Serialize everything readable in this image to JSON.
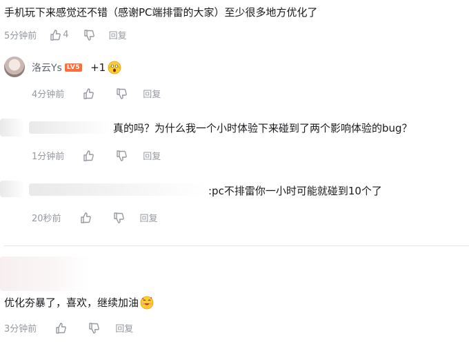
{
  "comments": [
    {
      "text": "手机玩下来感觉还不错（感谢PC端排雷的大家）至少很多地方优化了",
      "time": "5分钟前",
      "likes": "4",
      "reply_label": "回复"
    },
    {
      "username": "洛云Ys",
      "level": "LV5",
      "text": "+1",
      "time": "4分钟前",
      "reply_label": "回复"
    },
    {
      "text": "真的吗？为什么我一个小时体验下来碰到了两个影响体验的bug？",
      "time": "1分钟前",
      "reply_label": "回复"
    },
    {
      "text": ":pc不排雷你一小时可能就碰到10个了",
      "time": "20秒前",
      "reply_label": "回复"
    },
    {
      "text": "优化夯暴了，喜欢，继续加油",
      "time": "3分钟前",
      "reply_label": "回复"
    }
  ],
  "icons": {
    "like": "thumbs-up-icon",
    "dislike": "thumbs-down-icon",
    "emoji_shocked": "shocked-face-emoji",
    "emoji_heart_smile": "smiling-face-with-hearts-emoji"
  },
  "colors": {
    "meta_text": "#9499a0",
    "level_badge": "#ff6d3b",
    "divider": "#e3e5e7"
  }
}
